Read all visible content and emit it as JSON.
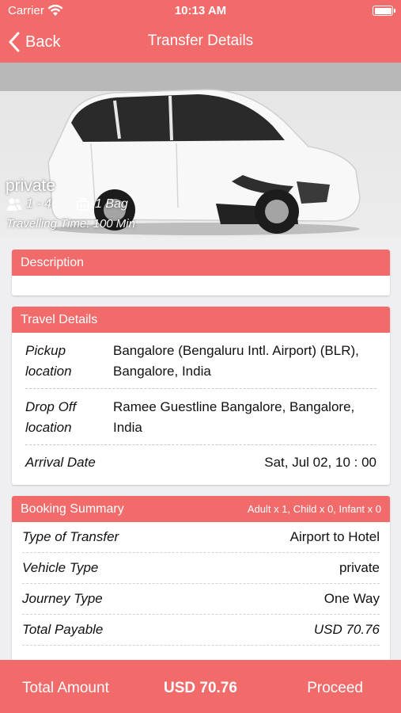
{
  "status_bar": {
    "carrier": "Carrier",
    "time": "10:13 AM"
  },
  "nav": {
    "back_label": "Back",
    "title": "Transfer Details"
  },
  "hero": {
    "vehicle_type": "private",
    "passengers": "1 - 4",
    "bags": "1 Bag",
    "travelling_time": "Travelling Time: 100 Min"
  },
  "description": {
    "header": "Description",
    "text": ""
  },
  "travel_details": {
    "header": "Travel Details",
    "pickup_label": "Pickup location",
    "pickup_value": "Bangalore (Bengaluru Intl. Airport) (BLR), Bangalore, India",
    "dropoff_label": "Drop Off location",
    "dropoff_value": "Ramee Guestline Bangalore, Bangalore, India",
    "arrival_label": "Arrival Date",
    "arrival_value": "Sat, Jul 02, 10 : 00"
  },
  "booking_summary": {
    "header": "Booking Summary",
    "pax": "Adult x 1, Child x 0, Infant x 0",
    "rows": [
      {
        "label": "Type of Transfer",
        "value": "Airport to Hotel"
      },
      {
        "label": "Vehicle Type",
        "value": "private"
      },
      {
        "label": "Journey Type",
        "value": "One Way"
      },
      {
        "label": "Total Payable",
        "value": "USD 70.76"
      }
    ]
  },
  "footer": {
    "total_label": "Total Amount",
    "total_value": "USD 70.76",
    "proceed_label": "Proceed"
  },
  "colors": {
    "accent": "#f26b6b",
    "background": "#efeff1"
  }
}
